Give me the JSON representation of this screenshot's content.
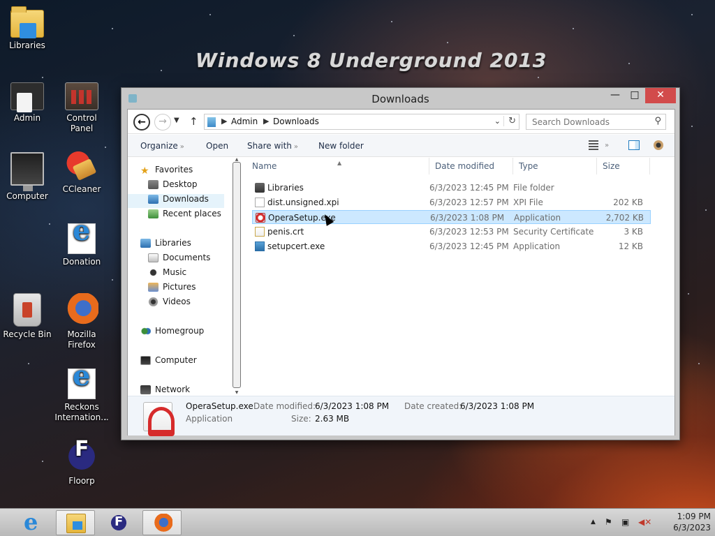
{
  "wallpaper": {
    "banner": "Windows 8 Underground 2013"
  },
  "desktop_icons": [
    {
      "label": "Libraries",
      "icon": "libraries-icon"
    },
    {
      "label": "Admin",
      "icon": "admin-icon"
    },
    {
      "label": "Control Panel",
      "icon": "control-panel-icon"
    },
    {
      "label": "Computer",
      "icon": "computer-icon"
    },
    {
      "label": "CCleaner",
      "icon": "ccleaner-icon"
    },
    {
      "label": "Donation",
      "icon": "internet-explorer-icon"
    },
    {
      "label": "Recycle Bin",
      "icon": "recycle-bin-icon"
    },
    {
      "label": "Mozilla Firefox",
      "icon": "firefox-icon"
    },
    {
      "label": "Reckons Internation...",
      "icon": "internet-explorer-icon"
    },
    {
      "label": "Floorp",
      "icon": "floorp-icon"
    }
  ],
  "window": {
    "title": "Downloads",
    "buttons": {
      "minimize": "—",
      "maximize": "□",
      "close": "✕"
    },
    "address": {
      "path": [
        "Admin",
        "Downloads"
      ]
    },
    "search": {
      "placeholder": "Search Downloads"
    },
    "commands": {
      "organize": "Organize",
      "open": "Open",
      "share": "Share with",
      "new_folder": "New folder"
    },
    "nav": {
      "favorites": "Favorites",
      "desktop": "Desktop",
      "downloads": "Downloads",
      "recent": "Recent places",
      "libraries": "Libraries",
      "documents": "Documents",
      "music": "Music",
      "pictures": "Pictures",
      "videos": "Videos",
      "homegroup": "Homegroup",
      "computer": "Computer",
      "network": "Network"
    },
    "columns": {
      "name": "Name",
      "date": "Date modified",
      "type": "Type",
      "size": "Size"
    },
    "files": [
      {
        "name": "Libraries",
        "date": "6/3/2023 12:45 PM",
        "type": "File folder",
        "size": ""
      },
      {
        "name": "dist.unsigned.xpi",
        "date": "6/3/2023 12:57 PM",
        "type": "XPI File",
        "size": "202 KB"
      },
      {
        "name": "OperaSetup.exe",
        "date": "6/3/2023 1:08 PM",
        "type": "Application",
        "size": "2,702 KB"
      },
      {
        "name": "penis.crt",
        "date": "6/3/2023 12:53 PM",
        "type": "Security Certificate",
        "size": "3 KB"
      },
      {
        "name": "setupcert.exe",
        "date": "6/3/2023 12:45 PM",
        "type": "Application",
        "size": "12 KB"
      }
    ],
    "details": {
      "name": "OperaSetup.exe",
      "type": "Application",
      "date_modified_label": "Date modified:",
      "date_modified": "6/3/2023 1:08 PM",
      "date_created_label": "Date created:",
      "date_created": "6/3/2023 1:08 PM",
      "size_label": "Size:",
      "size": "2.63 MB"
    }
  },
  "taskbar": {
    "clock": {
      "time": "1:09 PM",
      "date": "6/3/2023"
    }
  }
}
